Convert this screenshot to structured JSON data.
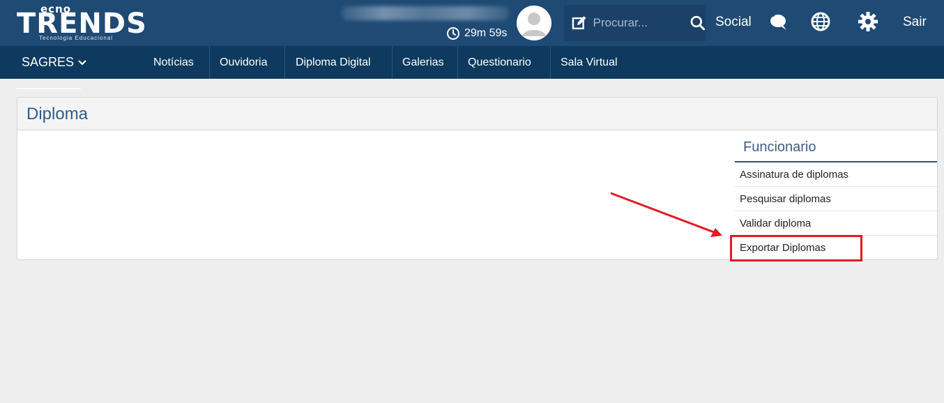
{
  "header": {
    "logo_word": "TRENDS",
    "logo_small": "ecno",
    "logo_tagline": "Tecnologia Educacional",
    "timer": "29m 59s",
    "search_placeholder": "Procurar...",
    "social_label": "Social",
    "logout_label": "Sair"
  },
  "nav": {
    "brand": "SAGRES",
    "items": [
      "Notícias",
      "Ouvidoria",
      "Diploma Digital",
      "Galerias",
      "Questionario",
      "Sala Virtual"
    ]
  },
  "panel": {
    "title": "Diploma",
    "sidebar_title": "Funcionario",
    "links": [
      "Assinatura de diplomas",
      "Pesquisar diplomas",
      "Validar diploma",
      "Exportar Diplomas"
    ]
  },
  "colors": {
    "topbar": "#1e4a74",
    "navbar": "#0d3a5e",
    "highlight": "#e01c24"
  },
  "icons": [
    "clock-icon",
    "avatar-icon",
    "edit-icon",
    "search-icon",
    "chat-icon",
    "globe-icon",
    "gear-icon",
    "chevron-down-icon"
  ]
}
